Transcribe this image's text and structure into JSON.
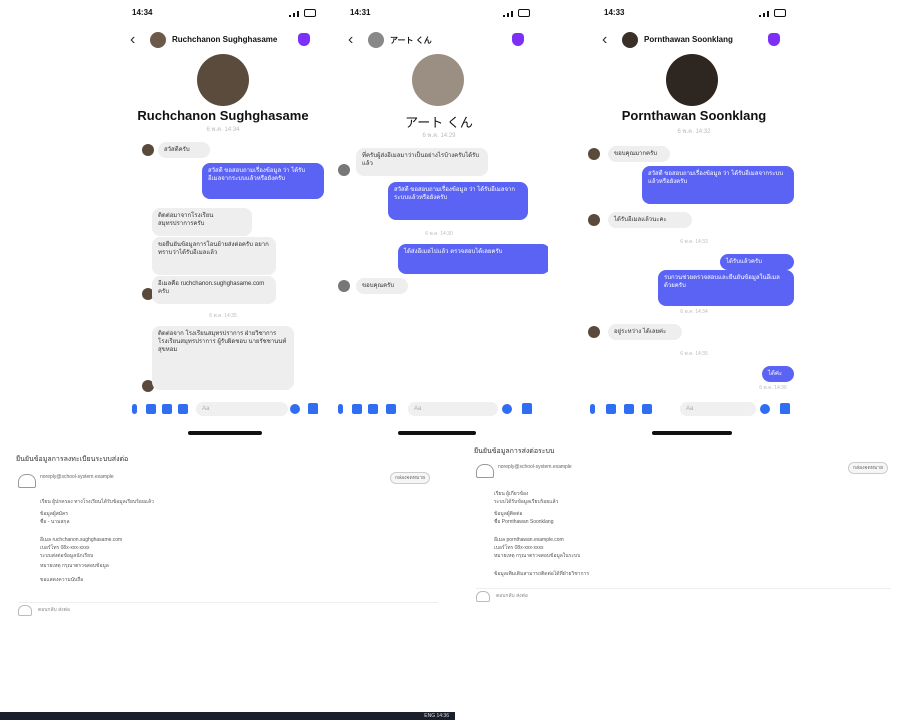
{
  "phones": [
    {
      "time": "14:34",
      "contact": "Ruchchanon Sughghasame",
      "header_name": "Ruchchanon Sughghasame",
      "meta": "6 พ.ค. 14:34",
      "messages": [
        {
          "dir": "in",
          "text": "สวัสดีครับ"
        },
        {
          "dir": "out",
          "text": "สวัสดี ขอสอบถามเรื่องข้อมูล ว่า ได้รับอีเมลจากระบบแล้วหรือยังครับ"
        },
        {
          "dir": "in",
          "text": "ติดต่อมาจากโรงเรียนสมุทรปราการครับ"
        },
        {
          "dir": "in",
          "text": "ขอยืนยันข้อมูลการโอนย้ายส่งต่อครับ อยากทราบว่าได้รับอีเมลแล้ว"
        },
        {
          "dir": "in",
          "text": "อีเมลคือ ruchchanon.sughghasame.com ครับ"
        },
        {
          "dir": "in",
          "text": "ติดต่อจาก โรงเรียนสมุทรปราการ ฝ่ายวิชาการ โรงเรียนสมุทรปราการ ผู้รับผิดชอบ นายรัชชานนท์ สุขหอม"
        }
      ],
      "timestamps": [
        "6 พ.ค. 14:35",
        "6 พ.ค. 14:36"
      ]
    },
    {
      "time": "14:31",
      "contact": "アート くん",
      "header_name": "アート くん",
      "meta": "6 พ.ค. 14:29",
      "messages": [
        {
          "dir": "in",
          "text": "ที่ครับผู้ส่งอีเมลมาว่าเป็นอย่างไรบ้างครับได้รับแล้ว"
        },
        {
          "dir": "out",
          "text": "สวัสดี ขอสอบถามเรื่องข้อมูล ว่า ได้รับอีเมลจากระบบแล้วหรือยังครับ"
        },
        {
          "dir": "out",
          "text": "ได้ส่งอีเมลไปแล้ว ตรวจสอบได้เลยครับ"
        },
        {
          "dir": "in",
          "text": "ขอบคุณครับ"
        }
      ],
      "timestamps": [
        "6 พ.ค. 14:30"
      ]
    },
    {
      "time": "14:33",
      "contact": "Pornthawan Soonklang",
      "header_name": "Pornthawan Soonklang",
      "meta": "6 พ.ค. 14:32",
      "messages": [
        {
          "dir": "in",
          "text": "ขอบคุณมากครับ"
        },
        {
          "dir": "out",
          "text": "สวัสดี ขอสอบถามเรื่องข้อมูล ว่า ได้รับอีเมลจากระบบแล้วหรือยังครับ"
        },
        {
          "dir": "in",
          "text": "ได้รับอีเมลแล้วนะคะ"
        },
        {
          "dir": "out",
          "text": "ได้รับแล้วครับ"
        },
        {
          "dir": "out",
          "text": "รบกวนช่วยตรวจสอบและยืนยันข้อมูลในอีเมลด้วยครับ"
        },
        {
          "dir": "in",
          "text": "อยู่ระหว่าง ได้เลยค่ะ"
        },
        {
          "dir": "out",
          "text": "ได้ค่ะ"
        }
      ],
      "timestamps": [
        "6 พ.ค. 14:33",
        "6 พ.ค. 14:34",
        "6 พ.ค. 14:35",
        "6 พ.ค. 14:36"
      ]
    }
  ],
  "composer_placeholder": "Aa",
  "emails": [
    {
      "subject": "ยืนยันข้อมูลการลงทะเบียนระบบส่งต่อ",
      "sender": "noreply@school-system.example",
      "tag": "กล่องจดหมาย",
      "lines": [
        "เรียน ผู้ปกครอง ทางโรงเรียนได้รับข้อมูลเรียบร้อยแล้ว",
        "ข้อมูลผู้สมัคร",
        "ชื่อ - นามสกุล",
        "อีเมล ruchchanon.sughghasame.com",
        "เบอร์โทร 08x-xxx-xxxx",
        "ระบบส่งต่อข้อมูลนักเรียน",
        "หมายเหตุ กรุณาตรวจสอบข้อมูล",
        "ขอแสดงความนับถือ"
      ],
      "reply": "ตอบกลับ ส่งต่อ"
    },
    {
      "subject": "ยืนยันข้อมูลการส่งต่อระบบ",
      "sender": "noreply@school-system.example",
      "tag": "กล่องจดหมาย",
      "lines": [
        "เรียน ผู้เกี่ยวข้อง",
        "ระบบได้รับข้อมูลเรียบร้อยแล้ว",
        "ข้อมูลผู้ติดต่อ",
        "ชื่อ Pornthawan Soonklang",
        "อีเมล pornthawan.example.com",
        "เบอร์โทร 08x-xxx-xxxx",
        "หมายเหตุ กรุณาตรวจสอบข้อมูลในระบบ",
        "ข้อมูลเพิ่มเติมสามารถติดต่อได้ที่ฝ่ายวิชาการ"
      ],
      "reply": "ตอบกลับ ส่งต่อ"
    }
  ],
  "taskbar_tray": "ENG 14:36"
}
